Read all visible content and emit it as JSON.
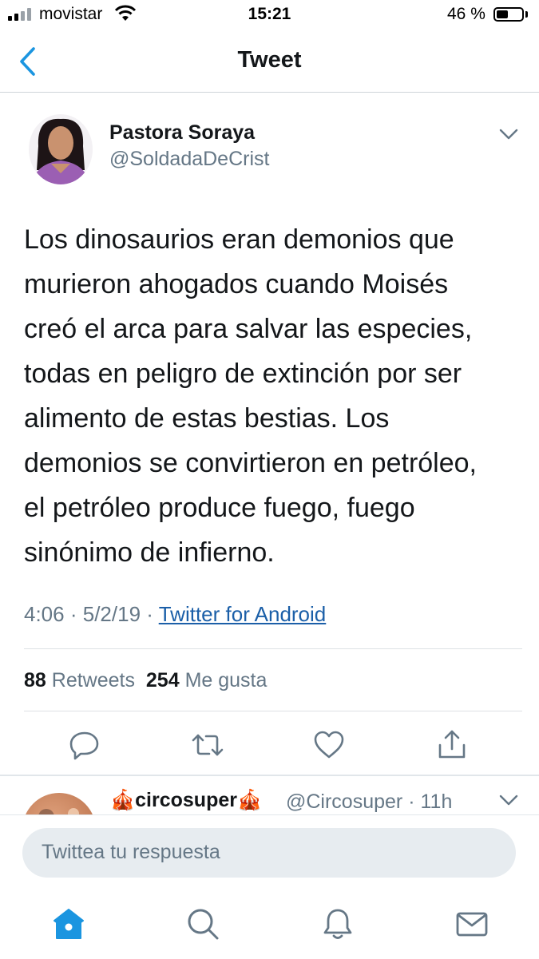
{
  "status_bar": {
    "carrier": "movistar",
    "time": "15:21",
    "battery": "46 %",
    "battery_level": 0.46
  },
  "nav": {
    "title": "Tweet",
    "back_icon": "back-chevron-icon"
  },
  "tweet": {
    "display_name": "Pastora Soraya",
    "handle": "@SoldadaDeCrist",
    "text": "Los dinosaurios eran demonios que\nmurieron ahogados cuando Moisés\ncreó el arca para salvar las especies,\ntodas en peligro de extinción por ser\nalimento de estas bestias. Los\ndemonios se convirtieron en petróleo,\nel petróleo produce fuego, fuego\nsinónimo de infierno.",
    "time": "4:06",
    "date": "5/2/19",
    "separator": "·",
    "source": "Twitter for Android",
    "retweets_count": "88",
    "retweets_label": "Retweets",
    "likes_count": "254",
    "likes_label": "Me gusta"
  },
  "reply": {
    "display_name": "circosuper",
    "handle": "@Circosuper",
    "time": "· 11h",
    "emoji": "🎪"
  },
  "composer": {
    "placeholder": "Twittea tu respuesta"
  },
  "tabs": [
    "home-icon",
    "search-icon",
    "notifications-icon",
    "messages-icon"
  ],
  "colors": {
    "accent": "#1b5fa8",
    "secondary_text": "#657786",
    "composer_bg": "#e7ecf0"
  }
}
